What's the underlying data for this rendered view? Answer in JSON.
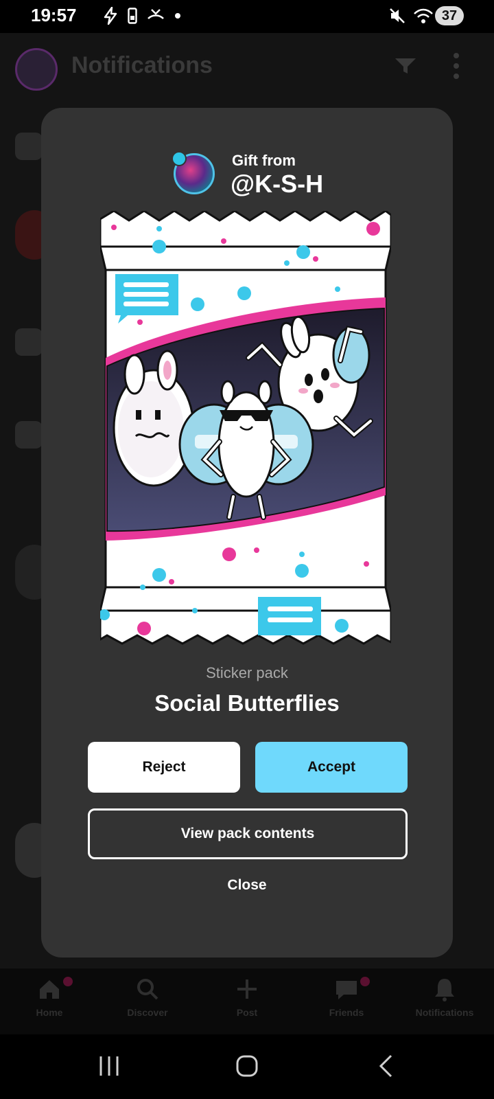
{
  "status_bar": {
    "time": "19:57",
    "battery": "37",
    "left_icons": [
      "charging-bolt-icon",
      "phone-storage-icon",
      "missed-call-icon",
      "dot-icon"
    ],
    "right_icons": [
      "mute-icon",
      "wifi-icon",
      "signal-icon"
    ]
  },
  "background_app": {
    "title": "Notifications",
    "nav": [
      {
        "label": "Home",
        "icon": "home-icon"
      },
      {
        "label": "Discover",
        "icon": "search-icon"
      },
      {
        "label": "Post",
        "icon": "plus-icon"
      },
      {
        "label": "Friends",
        "icon": "chat-icon"
      },
      {
        "label": "Notifications",
        "icon": "bell-icon"
      }
    ]
  },
  "gift": {
    "from_label": "Gift from",
    "username": "@K-S-H"
  },
  "pack": {
    "kind": "Sticker pack",
    "name": "Social Butterflies"
  },
  "actions": {
    "reject": "Reject",
    "accept": "Accept",
    "view_contents": "View pack contents",
    "close": "Close"
  },
  "colors": {
    "accent": "#6fd9fc",
    "modal_bg": "#333333",
    "pink": "#e8389a"
  }
}
